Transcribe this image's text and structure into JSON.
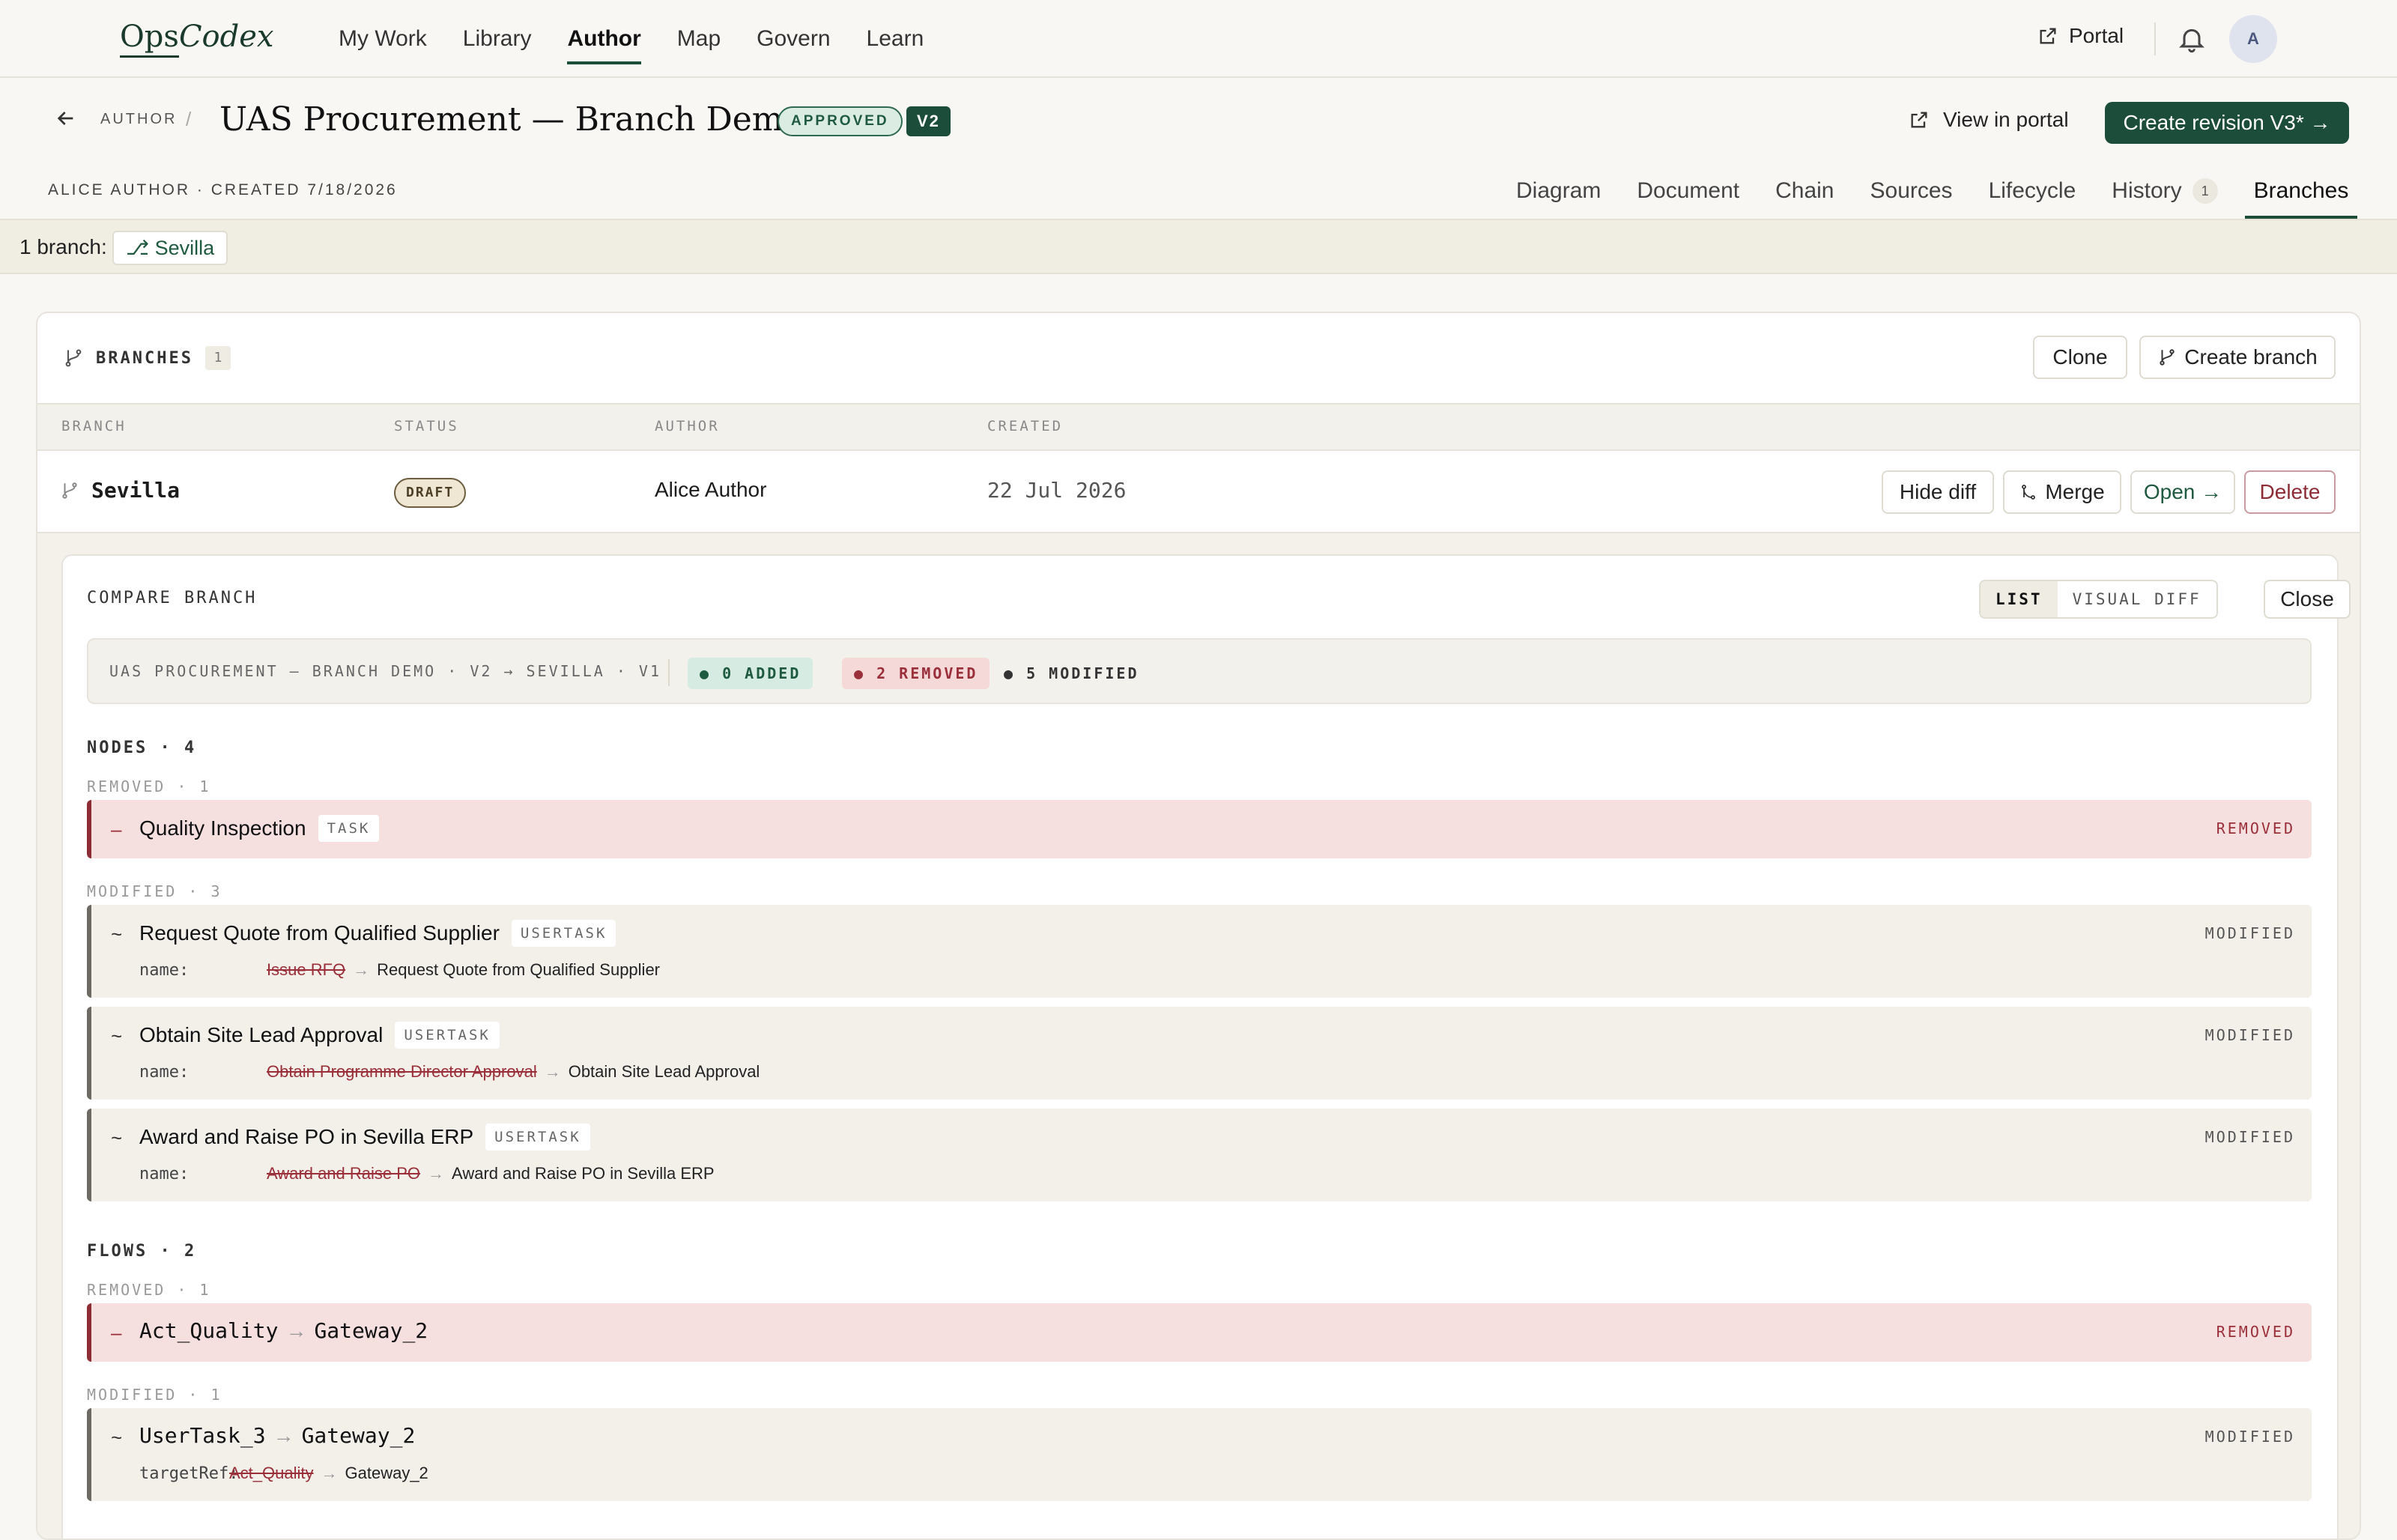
{
  "brand": {
    "part1": "Ops",
    "part2": "Codex"
  },
  "nav": [
    "My Work",
    "Library",
    "Author",
    "Map",
    "Govern",
    "Learn"
  ],
  "header": {
    "portal": "Portal",
    "avatar": "A"
  },
  "page": {
    "crumb": "AUTHOR",
    "crumb_sep": "/",
    "title": "UAS Procurement — Branch Demo",
    "status": "APPROVED",
    "version": "V2",
    "view_portal": "View in portal",
    "create_revision": "Create revision V3* →",
    "meta": "ALICE AUTHOR · CREATED 7/18/2026"
  },
  "tabs": [
    {
      "label": "Diagram"
    },
    {
      "label": "Document"
    },
    {
      "label": "Chain"
    },
    {
      "label": "Sources"
    },
    {
      "label": "Lifecycle"
    },
    {
      "label": "History",
      "count": "1"
    },
    {
      "label": "Branches",
      "active": true
    }
  ],
  "strip": {
    "label": "1 branch:",
    "chip": "⎇ Sevilla"
  },
  "branches": {
    "title": "BRANCHES",
    "count": "1",
    "clone": "Clone",
    "create": "Create branch",
    "columns": [
      "BRANCH",
      "STATUS",
      "AUTHOR",
      "CREATED"
    ],
    "row": {
      "name": "Sevilla",
      "status": "DRAFT",
      "author": "Alice Author",
      "created": "22 Jul 2026",
      "hide_diff": "Hide diff",
      "merge": "Merge",
      "open": "Open →",
      "delete": "Delete"
    }
  },
  "compare": {
    "title": "COMPARE BRANCH",
    "view_list": "LIST",
    "view_visual": "VISUAL DIFF",
    "close": "Close",
    "summary": "UAS PROCUREMENT — BRANCH DEMO · V2 → SEVILLA · V1",
    "added": "● 0 ADDED",
    "removed": "● 2 REMOVED",
    "modified": "● 5 MODIFIED",
    "nodes_title": "NODES · 4",
    "nodes_removed": "REMOVED · 1",
    "nodes_modified": "MODIFIED · 3",
    "flows_title": "FLOWS · 2",
    "flows_removed": "REMOVED · 1",
    "flows_modified": "MODIFIED · 1",
    "removed_label": "REMOVED",
    "modified_label": "MODIFIED",
    "node_removed": {
      "sign": "–",
      "name": "Quality Inspection",
      "type": "TASK"
    },
    "node_mods": [
      {
        "sign": "~",
        "name": "Request Quote from Qualified Supplier",
        "type": "USERTASK",
        "key": "name:",
        "old": "Issue RFQ",
        "new": "Request Quote from Qualified Supplier"
      },
      {
        "sign": "~",
        "name": "Obtain Site Lead Approval",
        "type": "USERTASK",
        "key": "name:",
        "old": "Obtain Programme Director Approval",
        "new": "Obtain Site Lead Approval"
      },
      {
        "sign": "~",
        "name": "Award and Raise PO in Sevilla ERP",
        "type": "USERTASK",
        "key": "name:",
        "old": "Award and Raise PO",
        "new": "Award and Raise PO in Sevilla ERP"
      }
    ],
    "flow_removed": {
      "sign": "–",
      "from": "Act_Quality",
      "to": "Gateway_2"
    },
    "flow_mod": {
      "sign": "~",
      "from": "UserTask_3",
      "to": "Gateway_2",
      "key": "targetRef:",
      "old": "Act_Quality",
      "new": "Gateway_2"
    },
    "arrow": "→"
  }
}
